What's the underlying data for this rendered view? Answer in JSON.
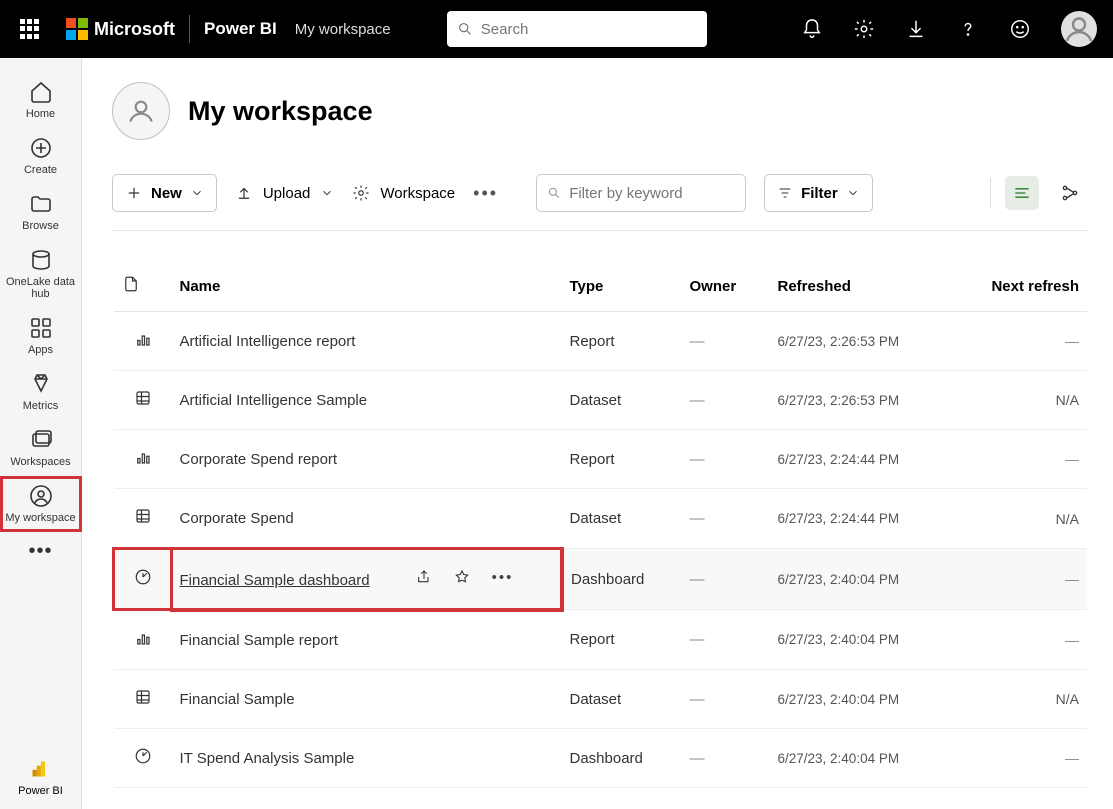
{
  "brand": {
    "ms": "Microsoft",
    "product": "Power BI"
  },
  "breadcrumb": "My workspace",
  "search": {
    "placeholder": "Search"
  },
  "rail": {
    "home": "Home",
    "create": "Create",
    "browse": "Browse",
    "onelake": "OneLake data hub",
    "apps": "Apps",
    "metrics": "Metrics",
    "workspaces": "Workspaces",
    "myws": "My workspace",
    "bottom": "Power BI"
  },
  "workspace": {
    "title": "My workspace"
  },
  "toolbar": {
    "new": "New",
    "upload": "Upload",
    "workspace_settings": "Workspace",
    "filter_placeholder": "Filter by keyword",
    "filter": "Filter"
  },
  "columns": {
    "name": "Name",
    "type": "Type",
    "owner": "Owner",
    "refreshed": "Refreshed",
    "next": "Next refresh"
  },
  "rows": [
    {
      "icon": "report",
      "name": "Artificial Intelligence report",
      "type": "Report",
      "owner": "—",
      "refreshed": "6/27/23, 2:26:53 PM",
      "next": "—"
    },
    {
      "icon": "dataset",
      "name": "Artificial Intelligence Sample",
      "type": "Dataset",
      "owner": "—",
      "refreshed": "6/27/23, 2:26:53 PM",
      "next": "N/A"
    },
    {
      "icon": "report",
      "name": "Corporate Spend report",
      "type": "Report",
      "owner": "—",
      "refreshed": "6/27/23, 2:24:44 PM",
      "next": "—"
    },
    {
      "icon": "dataset",
      "name": "Corporate Spend",
      "type": "Dataset",
      "owner": "—",
      "refreshed": "6/27/23, 2:24:44 PM",
      "next": "N/A"
    },
    {
      "icon": "dashboard",
      "name": "Financial Sample dashboard",
      "type": "Dashboard",
      "owner": "—",
      "refreshed": "6/27/23, 2:40:04 PM",
      "next": "—",
      "highlighted": true
    },
    {
      "icon": "report",
      "name": "Financial Sample report",
      "type": "Report",
      "owner": "—",
      "refreshed": "6/27/23, 2:40:04 PM",
      "next": "—"
    },
    {
      "icon": "dataset",
      "name": "Financial Sample",
      "type": "Dataset",
      "owner": "—",
      "refreshed": "6/27/23, 2:40:04 PM",
      "next": "N/A"
    },
    {
      "icon": "dashboard",
      "name": "IT Spend Analysis Sample",
      "type": "Dashboard",
      "owner": "—",
      "refreshed": "6/27/23, 2:40:04 PM",
      "next": "—"
    }
  ]
}
